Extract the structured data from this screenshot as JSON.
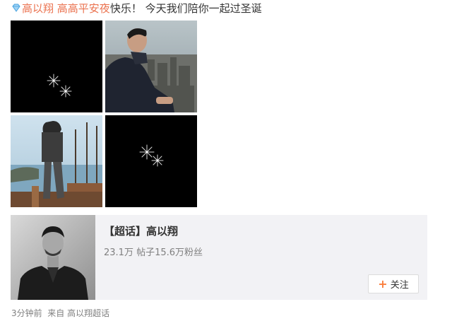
{
  "post": {
    "tag_user": "高以翔",
    "tag_topic": "高高平安夜",
    "text": "快乐！ 今天我们陪你一起过圣诞"
  },
  "images": [
    {
      "name": "sparkle-image-1"
    },
    {
      "name": "photo-man-city-view"
    },
    {
      "name": "photo-man-standing-harbor"
    },
    {
      "name": "sparkle-image-2"
    }
  ],
  "supertopic": {
    "title": "【超话】高以翔",
    "stats": "23.1万 帖子15.6万粉丝",
    "follow_label": "关注",
    "follow_icon": "plus-icon"
  },
  "footer": {
    "time": "3分钟前",
    "from_label": "来自",
    "source": "高以翔超话"
  },
  "colors": {
    "link": "#eb7350",
    "card_bg": "#f2f2f5",
    "follow_plus": "#fa7d3c"
  }
}
